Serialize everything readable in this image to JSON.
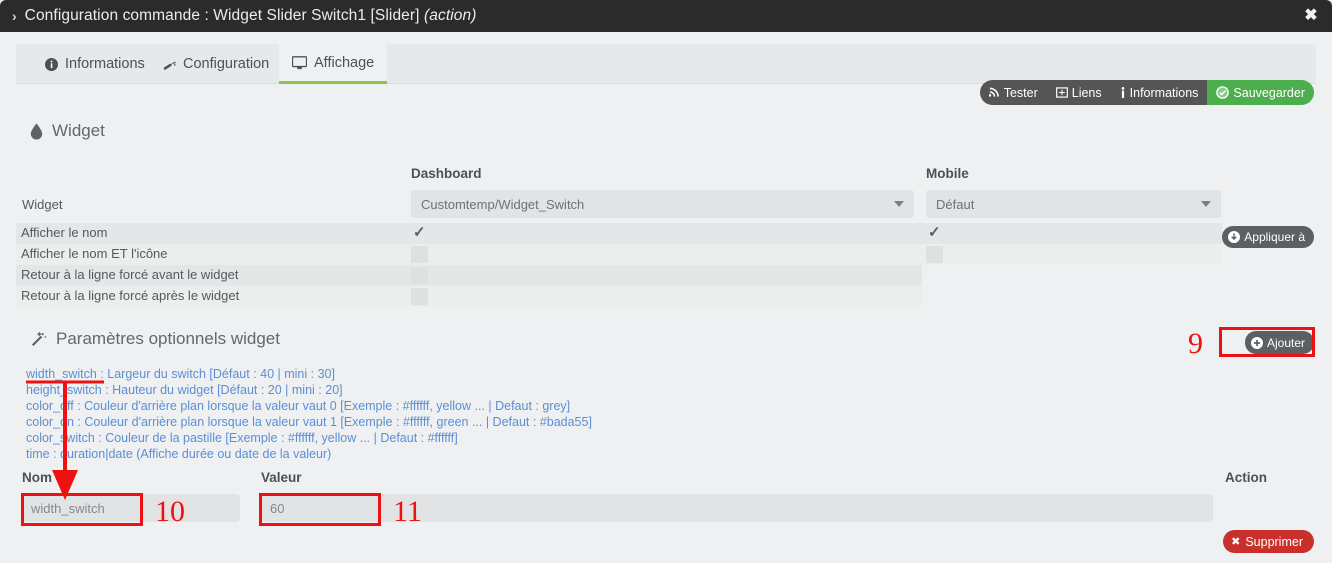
{
  "window": {
    "title_prefix": "Configuration commande : Widget Slider Switch1 [Slider]",
    "title_italic": "(action)",
    "chevron": "›",
    "close": "✖"
  },
  "tabs": [
    {
      "label": "Informations",
      "icon": "info-circle-icon",
      "active": false
    },
    {
      "label": "Configuration",
      "icon": "wrench-icon",
      "active": false
    },
    {
      "label": "Affichage",
      "icon": "desktop-icon",
      "active": true
    }
  ],
  "toolbar": {
    "buttons": [
      {
        "label": "Tester",
        "icon": "rss-icon",
        "style": "dark"
      },
      {
        "label": "Liens",
        "icon": "link-box-icon",
        "style": "dark"
      },
      {
        "label": "Informations",
        "icon": "info-icon",
        "style": "dark"
      },
      {
        "label": "Sauvegarder",
        "icon": "check-circle-icon",
        "style": "green"
      }
    ]
  },
  "widget_section": {
    "title": "Widget",
    "icon": "tint-droplet-icon",
    "col_dashboard": "Dashboard",
    "col_mobile": "Mobile",
    "row_widget_label": "Widget",
    "dashboard_select_value": "Customtemp/Widget_Switch",
    "mobile_select_value": "Défaut",
    "apply_button": "Appliquer à",
    "apply_icon": "download-circle-icon",
    "rows": [
      {
        "label": "Afficher le nom",
        "dashboard_checked": true,
        "mobile_checked": true,
        "has_mobile": true
      },
      {
        "label": "Afficher le nom ET l'icône",
        "dashboard_checked": false,
        "mobile_checked": false,
        "has_mobile": true
      },
      {
        "label": "Retour à la ligne forcé avant le widget",
        "dashboard_checked": false,
        "mobile_checked": false,
        "has_mobile": false
      },
      {
        "label": "Retour à la ligne forcé après le widget",
        "dashboard_checked": false,
        "mobile_checked": false,
        "has_mobile": false
      }
    ]
  },
  "params_section": {
    "title": "Paramètres optionnels widget",
    "icon": "magic-wand-icon",
    "add_button": "Ajouter",
    "add_icon": "plus-circle-icon",
    "help_lines": [
      "width_switch : Largeur du switch [Défaut : 40 | mini : 30]",
      "height_switch : Hauteur du widget [Défaut : 20 | mini : 20]",
      "color_off : Couleur d'arrière plan lorsque la valeur vaut 0 [Exemple : #ffffff, yellow ... | Defaut : grey]",
      "color_on : Couleur d'arrière plan lorsque la valeur vaut 1 [Exemple : #ffffff, green ... | Defaut : #bada55]",
      "color_switch : Couleur de la pastille [Exemple : #ffffff, yellow ... | Defaut : #ffffff]",
      "time : duration|date (Affiche durée ou date de la valeur)"
    ],
    "col_nom": "Nom",
    "col_valeur": "Valeur",
    "col_action": "Action",
    "param_name_value": "width_switch",
    "param_value_value": "60",
    "delete_button": "Supprimer",
    "delete_icon": "x-icon"
  },
  "annotations": [
    {
      "id": "9",
      "number": "9"
    },
    {
      "id": "10",
      "number": "10"
    },
    {
      "id": "11",
      "number": "11"
    }
  ],
  "colors": {
    "accent_green": "#4cae4c",
    "tab_underline": "#8bc34a",
    "danger_red": "#c9302c",
    "annotation_red": "#ee1111",
    "link_blue": "#5b8fd4",
    "titlebar": "#2b2b2b"
  }
}
